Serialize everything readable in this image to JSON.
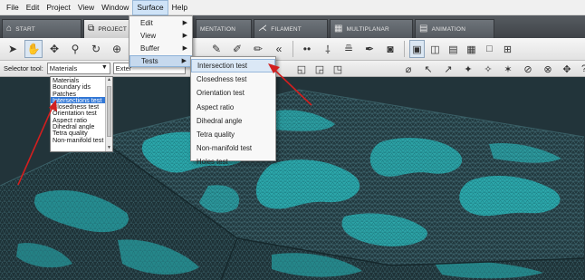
{
  "menubar": [
    "File",
    "Edit",
    "Project",
    "View",
    "Window",
    "Surface",
    "Help"
  ],
  "tabs": [
    {
      "label": "START",
      "icon": "home-icon"
    },
    {
      "label": "PROJECT",
      "icon": "project-icon"
    },
    {
      "label": "MENTATION",
      "icon": "segmentation-icon"
    },
    {
      "label": "FILAMENT",
      "icon": "filament-icon"
    },
    {
      "label": "MULTIPLANAR",
      "icon": "multiplanar-icon"
    },
    {
      "label": "ANIMATION",
      "icon": "animation-icon"
    }
  ],
  "selector": {
    "label": "Selector tool:",
    "value": "Materials",
    "extent_value": "Exter"
  },
  "selector_list": {
    "items": [
      "Materials",
      "Boundary ids",
      "Patches",
      "Intersections test",
      "Closedness test",
      "Orientation test",
      "Aspect ratio",
      "Dihedral angle",
      "Tetra quality",
      "Non-manifold test"
    ],
    "selected_index": 3
  },
  "surface_menu": {
    "items": [
      "Edit",
      "View",
      "Buffer",
      "Tests"
    ],
    "highlighted": "Tests"
  },
  "tests_menu": {
    "items": [
      "Intersection test",
      "Closedness test",
      "Orientation test",
      "Aspect ratio",
      "Dihedral angle",
      "Tetra quality",
      "Non-manifold test",
      "Holes test"
    ],
    "highlighted": "Intersection test"
  },
  "colors": {
    "mesh_dark": "#2c4a52",
    "mesh_cyan": "#2fc6c8",
    "annotation_arrow": "#d21f1f",
    "selection_blue": "#3378d6"
  }
}
